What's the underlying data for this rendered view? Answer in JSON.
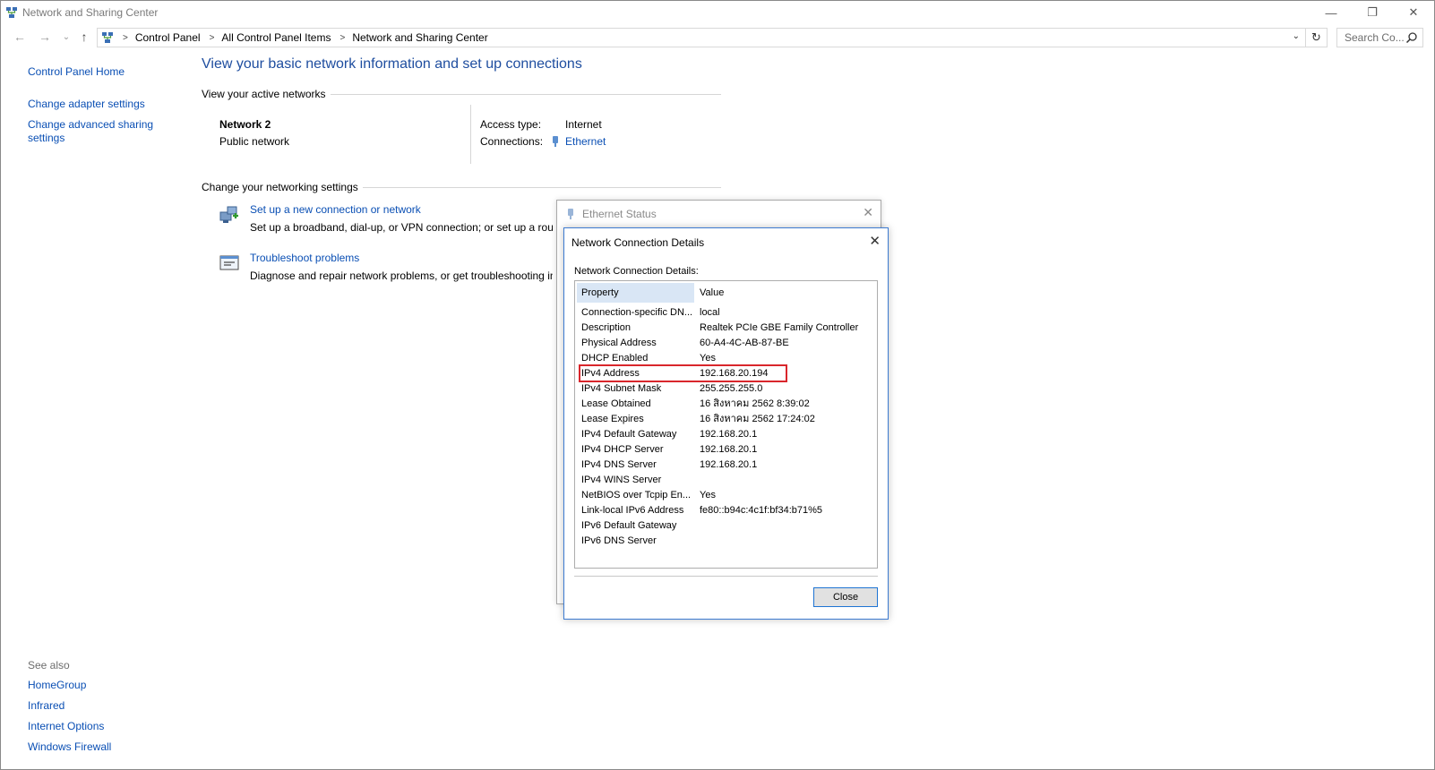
{
  "window": {
    "title": "Network and Sharing Center",
    "controls": {
      "minimize": "—",
      "restore": "❐",
      "close": "✕"
    }
  },
  "navbar": {
    "back": "←",
    "forward": "→",
    "recent": "⌄",
    "up": "↑",
    "breadcrumb": [
      "Control Panel",
      "All Control Panel Items",
      "Network and Sharing Center"
    ],
    "search_placeholder": "Search Co..."
  },
  "left_pane": {
    "home": "Control Panel Home",
    "links": [
      "Change adapter settings",
      "Change advanced sharing settings"
    ],
    "see_also_label": "See also",
    "see_also": [
      "HomeGroup",
      "Infrared",
      "Internet Options",
      "Windows Firewall"
    ]
  },
  "main": {
    "heading": "View your basic network information and set up connections",
    "active_networks_label": "View your active networks",
    "network_name": "Network  2",
    "network_type": "Public network",
    "access_type_label": "Access type:",
    "access_type_value": "Internet",
    "connections_label": "Connections:",
    "connections_value": "Ethernet",
    "change_settings_label": "Change your networking settings",
    "tasks": [
      {
        "title": "Set up a new connection or network",
        "desc": "Set up a broadband, dial-up, or VPN connection; or set up a router or access point."
      },
      {
        "title": "Troubleshoot problems",
        "desc": "Diagnose and repair network problems, or get troubleshooting information."
      }
    ]
  },
  "ethernet_status": {
    "title": "Ethernet Status"
  },
  "details_dialog": {
    "title": "Network Connection Details",
    "list_label": "Network Connection Details:",
    "columns": {
      "property": "Property",
      "value": "Value"
    },
    "rows": [
      {
        "p": "Connection-specific DN...",
        "v": "local"
      },
      {
        "p": "Description",
        "v": "Realtek PCIe GBE Family Controller"
      },
      {
        "p": "Physical Address",
        "v": "60-A4-4C-AB-87-BE"
      },
      {
        "p": "DHCP Enabled",
        "v": "Yes"
      },
      {
        "p": "IPv4 Address",
        "v": "192.168.20.194"
      },
      {
        "p": "IPv4 Subnet Mask",
        "v": "255.255.255.0"
      },
      {
        "p": "Lease Obtained",
        "v": "16 สิงหาคม 2562 8:39:02"
      },
      {
        "p": "Lease Expires",
        "v": "16 สิงหาคม 2562 17:24:02"
      },
      {
        "p": "IPv4 Default Gateway",
        "v": "192.168.20.1"
      },
      {
        "p": "IPv4 DHCP Server",
        "v": "192.168.20.1"
      },
      {
        "p": "IPv4 DNS Server",
        "v": "192.168.20.1"
      },
      {
        "p": "IPv4 WINS Server",
        "v": ""
      },
      {
        "p": "NetBIOS over Tcpip En...",
        "v": "Yes"
      },
      {
        "p": "Link-local IPv6 Address",
        "v": "fe80::b94c:4c1f:bf34:b71%5"
      },
      {
        "p": "IPv6 Default Gateway",
        "v": ""
      },
      {
        "p": "IPv6 DNS Server",
        "v": ""
      }
    ],
    "close_label": "Close"
  },
  "colors": {
    "link": "#0a4fb4",
    "heading": "#1e4d9f",
    "highlight": "#d9262c",
    "dialog_border": "#3d7bd1"
  }
}
